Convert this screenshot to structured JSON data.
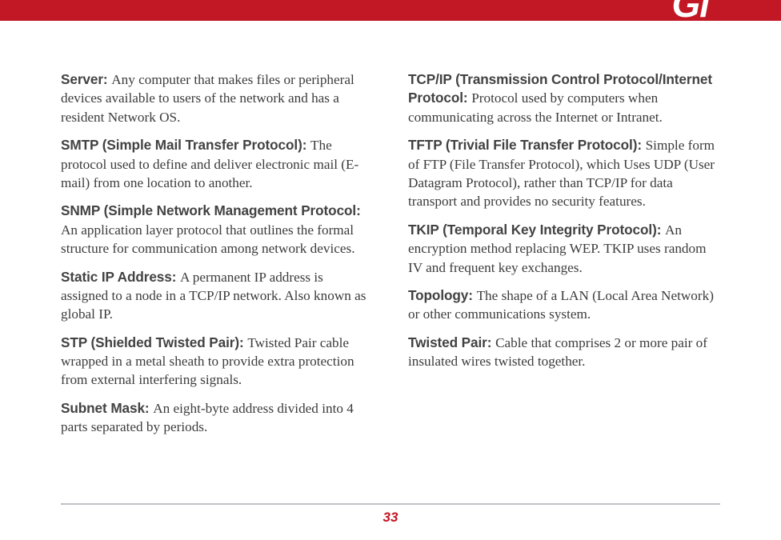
{
  "header": {
    "corner": "Gl"
  },
  "columns": {
    "left": [
      {
        "term": "Server:",
        "def": "Any computer that makes files or peripheral devices available to users of the network and has a resident Network OS."
      },
      {
        "term": "SMTP (Simple Mail Transfer Protocol):",
        "def": "The protocol used to define and deliver electronic mail (E-mail) from one location to another."
      },
      {
        "term": "SNMP (Simple Network Management Protocol:",
        "def": "An application layer protocol that outlines the formal structure for communication among network devices."
      },
      {
        "term": "Static IP Address:",
        "def": "A permanent IP address is assigned to a node in a TCP/IP network. Also known as global IP."
      },
      {
        "term": "STP (Shielded Twisted Pair):",
        "def": "Twisted Pair cable wrapped in a metal sheath to provide extra protection from external interfering signals."
      },
      {
        "term": "Subnet Mask:",
        "def": "An eight-byte address divided into 4 parts separated by periods."
      }
    ],
    "right": [
      {
        "term": "TCP/IP (Transmission Control Protocol/Internet Protocol:",
        "def": "Protocol used by computers when communicating across the Internet or Intranet."
      },
      {
        "term": "TFTP (Trivial File Transfer Protocol):",
        "def": "Simple form of FTP (File Transfer Protocol), which Uses UDP (User Datagram Protocol), rather than TCP/IP for data transport and provides no security features."
      },
      {
        "term": "TKIP (Temporal Key Integrity Protocol):",
        "def": "An encryption method replacing WEP. TKIP uses random IV and frequent key exchanges."
      },
      {
        "term": "Topology:",
        "def": "The shape of a LAN (Local Area Network) or other communications system."
      },
      {
        "term": "Twisted Pair:",
        "def": "Cable that comprises 2 or more pair of insulated wires twisted together."
      }
    ]
  },
  "footer": {
    "page_number": "33"
  }
}
